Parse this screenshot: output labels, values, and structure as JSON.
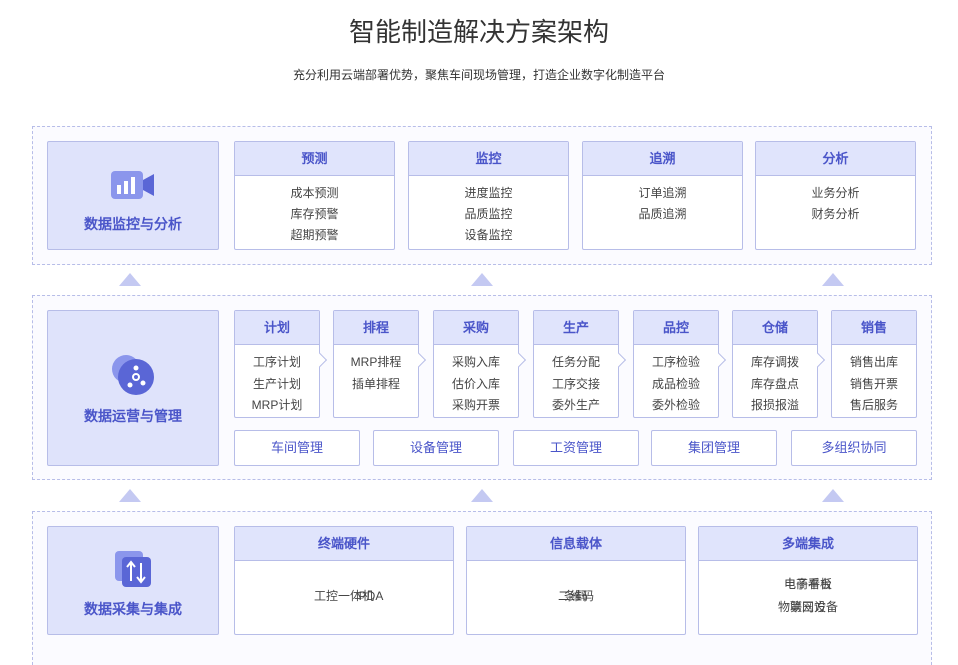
{
  "title": "智能制造解决方案架构",
  "subtitle": "充分利用云端部署优势，聚焦车间现场管理，打造企业数字化制造平台",
  "colors": {
    "accent": "#4a55c9",
    "panel": "#dfe3fb",
    "border": "#b7bde8",
    "arrow": "#c4c9f2"
  },
  "layer1": {
    "label": "数据监控与分析",
    "icon": "video-chart-icon",
    "modules": [
      {
        "title": "预测",
        "items": [
          "成本预测",
          "库存预警",
          "超期预警"
        ]
      },
      {
        "title": "监控",
        "items": [
          "进度监控",
          "品质监控",
          "设备监控"
        ]
      },
      {
        "title": "追溯",
        "items": [
          "订单追溯",
          "品质追溯"
        ]
      },
      {
        "title": "分析",
        "items": [
          "业务分析",
          "财务分析"
        ]
      }
    ]
  },
  "layer2": {
    "label": "数据运营与管理",
    "icon": "cloud-share-icon",
    "modules": [
      {
        "title": "计划",
        "items": [
          "工序计划",
          "生产计划",
          "MRP计划"
        ]
      },
      {
        "title": "排程",
        "items": [
          "MRP排程",
          "插单排程"
        ]
      },
      {
        "title": "采购",
        "items": [
          "采购入库",
          "估价入库",
          "采购开票"
        ]
      },
      {
        "title": "生产",
        "items": [
          "任务分配",
          "工序交接",
          "委外生产"
        ]
      },
      {
        "title": "品控",
        "items": [
          "工序检验",
          "成品检验",
          "委外检验"
        ]
      },
      {
        "title": "仓储",
        "items": [
          "库存调拨",
          "库存盘点",
          "报损报溢"
        ]
      },
      {
        "title": "销售",
        "items": [
          "销售出库",
          "销售开票",
          "售后服务"
        ]
      }
    ],
    "management": [
      "车间管理",
      "设备管理",
      "工资管理",
      "集团管理",
      "多组织协同"
    ]
  },
  "layer3": {
    "label": "数据采集与集成",
    "icon": "transfer-arrows-icon",
    "modules": [
      {
        "title": "终端硬件",
        "items": [
          "工控一体机",
          "PDA"
        ]
      },
      {
        "title": "信息载体",
        "items": [
          "条码",
          "二维码"
        ]
      },
      {
        "title": "多端集成",
        "items": [
          "电子看板",
          "电商平台",
          "物联网设备",
          "第三方"
        ]
      }
    ]
  }
}
